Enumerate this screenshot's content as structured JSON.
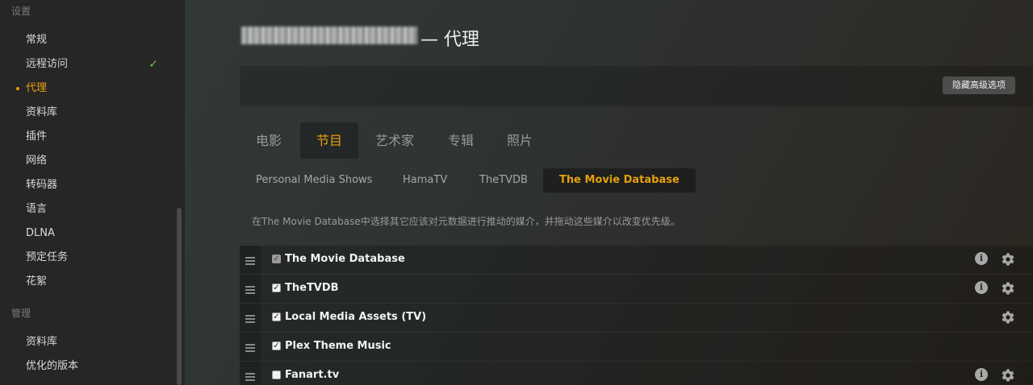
{
  "sidebar": {
    "section_settings": "设置",
    "section_manage": "管理",
    "settings_items": [
      {
        "label": "常规"
      },
      {
        "label": "远程访问",
        "status_icon": "check-icon",
        "status_color": "#6fbf3f"
      },
      {
        "label": "代理",
        "active": true
      },
      {
        "label": "资料库"
      },
      {
        "label": "插件"
      },
      {
        "label": "网络"
      },
      {
        "label": "转码器"
      },
      {
        "label": "语言"
      },
      {
        "label": "DLNA"
      },
      {
        "label": "预定任务"
      },
      {
        "label": "花絮"
      }
    ],
    "manage_items": [
      {
        "label": "资料库"
      },
      {
        "label": "优化的版本"
      }
    ]
  },
  "header": {
    "title_suffix": "— 代理"
  },
  "advanced_toggle_label": "隐藏高级选项",
  "media_tabs": [
    {
      "label": "电影"
    },
    {
      "label": "节目",
      "active": true
    },
    {
      "label": "艺术家"
    },
    {
      "label": "专辑"
    },
    {
      "label": "照片"
    }
  ],
  "agent_tabs": [
    {
      "label": "Personal Media Shows"
    },
    {
      "label": "HamaTV"
    },
    {
      "label": "TheTVDB"
    },
    {
      "label": "The Movie Database",
      "active": true
    }
  ],
  "description": "在The Movie Database中选择其它应该对元数据进行推动的媒介，并拖动这些媒介以改变优先级。",
  "agents": [
    {
      "name": "The Movie Database",
      "checked": true,
      "disabled": true,
      "info": true,
      "settings": true
    },
    {
      "name": "TheTVDB",
      "checked": true,
      "info": true,
      "settings": true
    },
    {
      "name": "Local Media Assets (TV)",
      "checked": true,
      "info": false,
      "settings": true
    },
    {
      "name": "Plex Theme Music",
      "checked": true,
      "info": false,
      "settings": false
    },
    {
      "name": "Fanart.tv",
      "checked": false,
      "info": true,
      "settings": true
    }
  ],
  "colors": {
    "accent": "#e5a00d",
    "check_green": "#6fbf3f"
  }
}
